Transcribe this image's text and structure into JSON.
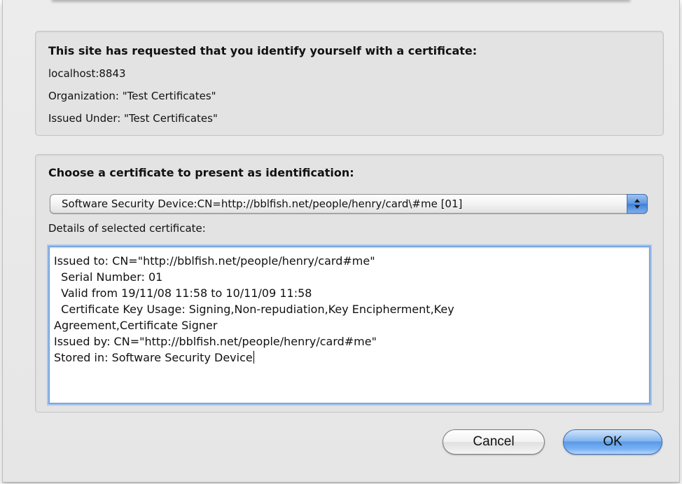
{
  "request": {
    "heading": "This site has requested that you identify yourself with a certificate:",
    "host": "localhost:8843",
    "organization": "Organization: \"Test Certificates\"",
    "issued_under": "Issued Under: \"Test Certificates\""
  },
  "choose": {
    "heading": "Choose a certificate to present as identification:",
    "selected_certificate": "Software Security Device:CN=http://bblfish.net/people/henry/card\\#me [01]",
    "details_label": "Details of selected certificate:"
  },
  "details": {
    "lines": [
      "Issued to: CN=\"http://bblfish.net/people/henry/card#me\"",
      "  Serial Number: 01",
      "  Valid from 19/11/08 11:58 to 10/11/09 11:58",
      "  Certificate Key Usage: Signing,Non-repudiation,Key Encipherment,Key",
      "Agreement,Certificate Signer",
      "Issued by: CN=\"http://bblfish.net/people/henry/card#me\"",
      "Stored in: Software Security Device"
    ]
  },
  "buttons": {
    "cancel_label": "Cancel",
    "ok_label": "OK"
  },
  "colors": {
    "dialog_background": "#e8e8e8",
    "focus_ring": "#79a6e0",
    "ok_button": "#5c9ae6"
  },
  "icons": {
    "popup_arrows": "updown-arrows-icon"
  }
}
